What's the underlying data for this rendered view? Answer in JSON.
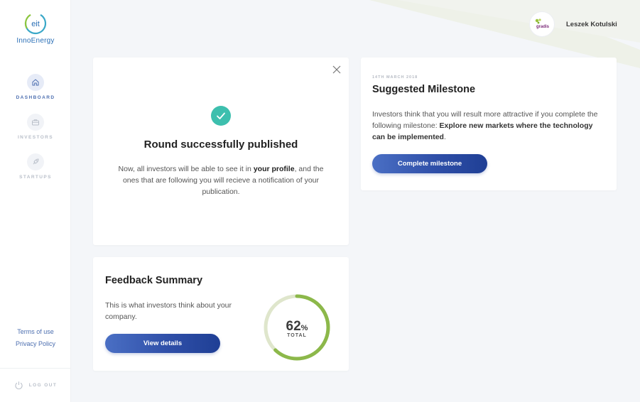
{
  "brand": {
    "logo_mark": "eit",
    "name": "InnoEnergy"
  },
  "nav": {
    "items": [
      {
        "label": "DASHBOARD",
        "icon": "home-icon",
        "active": true
      },
      {
        "label": "INVESTORS",
        "icon": "briefcase-icon",
        "active": false
      },
      {
        "label": "STARTUPS",
        "icon": "rocket-icon",
        "active": false
      }
    ]
  },
  "side_links": {
    "terms": "Terms of use",
    "privacy": "Privacy Policy"
  },
  "logout": {
    "label": "LOG OUT",
    "icon": "power-icon"
  },
  "user": {
    "name": "Leszek Kotulski",
    "avatar_text": "gradis"
  },
  "round_card": {
    "title": "Round successfully published",
    "text_before": "Now, all investors will be able to see it in ",
    "text_bold": "your profile",
    "text_after": ", and the ones that are following you will recieve a notification of your publication.",
    "close_icon": "close-icon",
    "check_icon": "check-icon"
  },
  "milestone_card": {
    "date": "14TH MARCH 2018",
    "title": "Suggested Milestone",
    "text_before": "Investors think that you will result more attractive if you complete the following milestone: ",
    "text_bold": "Explore new markets where the technology can be implemented",
    "text_after": ".",
    "button_label": "Complete milestone"
  },
  "feedback_card": {
    "title": "Feedback Summary",
    "text": "This is what investors think about your company.",
    "button_label": "View details",
    "gauge_value": "62",
    "gauge_unit": "%",
    "gauge_label": "TOTAL",
    "gauge_fraction": 0.62
  },
  "colors": {
    "accent": "#2f4fa8",
    "success": "#3dbfae",
    "gauge_fill": "#8cb84a",
    "gauge_track": "#dfe6cc"
  }
}
